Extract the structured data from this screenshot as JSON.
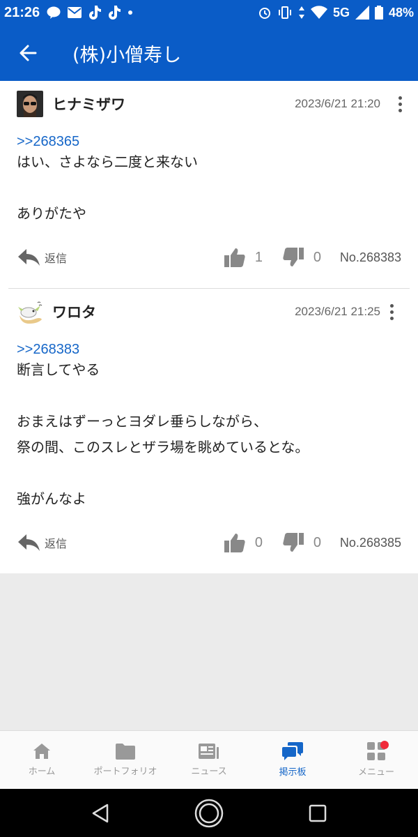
{
  "status_bar": {
    "time": "21:26",
    "network": "5G",
    "battery": "48%",
    "icons": [
      "line-icon",
      "mail-icon",
      "tiktok-icon",
      "tiktok-icon",
      "dot-icon",
      "alarm-icon",
      "vibrate-icon",
      "wifi-icon",
      "signal-icon",
      "battery-icon"
    ]
  },
  "app_bar": {
    "title": "(株)小僧寿し"
  },
  "colors": {
    "primary": "#0a5cc7",
    "link": "#1566c8",
    "badge": "#f02a3a"
  },
  "posts": [
    {
      "username": "ヒナミザワ",
      "timestamp": "2023/6/21 21:20",
      "reply_to": ">>268365",
      "body": [
        "はい、さよなら二度と来ない",
        "",
        "ありがたや"
      ],
      "reply_label": "返信",
      "likes": "1",
      "dislikes": "0",
      "number": "No.268383"
    },
    {
      "username": "ワロタ",
      "timestamp": "2023/6/21 21:25",
      "reply_to": ">>268383",
      "body": [
        "断言してやる",
        "",
        "おまえはずーっとヨダレ垂らしながら、",
        "祭の間、このスレとザラ場を眺めているとな。",
        "",
        "強がんなよ"
      ],
      "reply_label": "返信",
      "likes": "0",
      "dislikes": "0",
      "number": "No.268385"
    }
  ],
  "bottom_nav": [
    {
      "label": "ホーム",
      "icon": "home-icon",
      "active": false
    },
    {
      "label": "ポートフォリオ",
      "icon": "folder-icon",
      "active": false
    },
    {
      "label": "ニュース",
      "icon": "news-icon",
      "active": false
    },
    {
      "label": "掲示板",
      "icon": "chat-icon",
      "active": true
    },
    {
      "label": "メニュー",
      "icon": "menu-grid-icon",
      "active": false,
      "badge": true
    }
  ]
}
